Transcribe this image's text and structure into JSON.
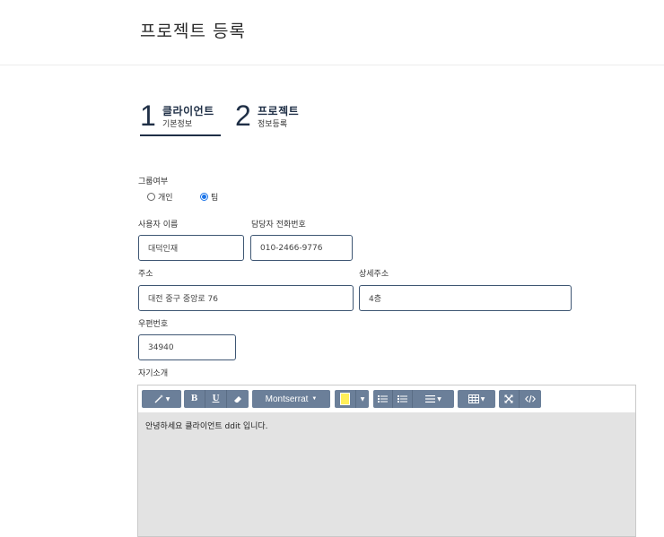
{
  "page": {
    "title": "프로젝트 등록"
  },
  "steps": [
    {
      "number": "1",
      "title": "클라이언트",
      "subtitle": "기본정보",
      "active": true
    },
    {
      "number": "2",
      "title": "프로젝트",
      "subtitle": "정보등록",
      "active": false
    }
  ],
  "form": {
    "group_label": "그룹여부",
    "radio_options": [
      {
        "label": "개인",
        "checked": false
      },
      {
        "label": "팀",
        "checked": true
      }
    ],
    "user_name": {
      "label": "사용자 이름",
      "value": "대덕인재"
    },
    "manager_phone": {
      "label": "담당자 전화번호",
      "value": "010-2466-9776"
    },
    "address": {
      "label": "주소",
      "value": "대전 중구 중앙로 76"
    },
    "address_detail": {
      "label": "상세주소",
      "value": "4층"
    },
    "postal_code": {
      "label": "우편번호",
      "value": "34940"
    },
    "intro": {
      "label": "자기소개",
      "content": "안녕하세요 클라이언트 ddit 입니다."
    }
  },
  "editor_toolbar": {
    "font_name": "Montserrat",
    "highlight_color": "#ffef5a",
    "icons": [
      "magic-wand-icon",
      "bold-icon",
      "underline-icon",
      "eraser-icon",
      "font-family-dropdown",
      "highlight-color-icon",
      "unordered-list-icon",
      "ordered-list-icon",
      "paragraph-align-icon",
      "table-icon",
      "fullscreen-icon",
      "code-view-icon"
    ],
    "bold_glyph": "B",
    "underline_glyph": "U"
  },
  "colors": {
    "accent": "#1f2f46",
    "input_border": "#3e5673",
    "toolbar": "#6b7f99"
  }
}
